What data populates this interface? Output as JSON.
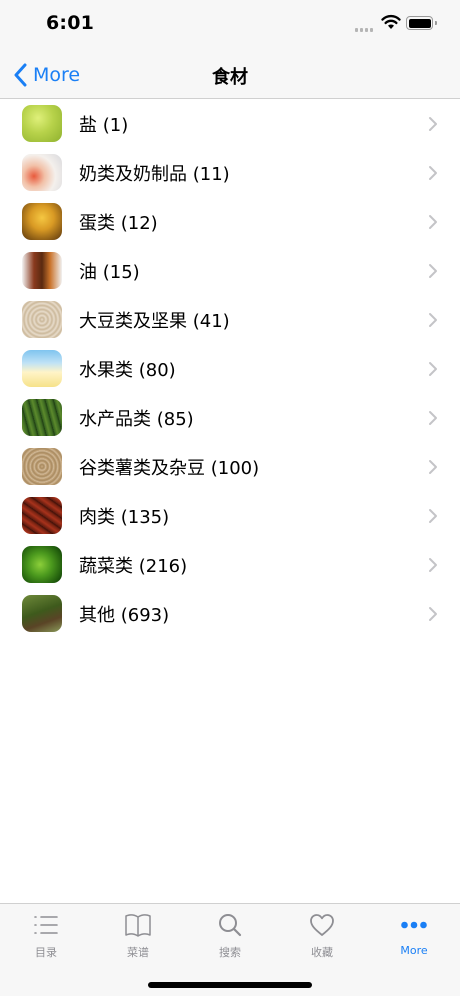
{
  "status_bar": {
    "time": "6:01"
  },
  "nav": {
    "back_label": "More",
    "title": "食材"
  },
  "colors": {
    "accent": "#1a7ff5",
    "inactive": "#8e8e93",
    "separator": "#d0d0d0",
    "bar_background": "#f7f7f7"
  },
  "categories": [
    {
      "label": "盐 (1)",
      "icon": "salt-thumbnail"
    },
    {
      "label": "奶类及奶制品 (11)",
      "icon": "dairy-thumbnail"
    },
    {
      "label": "蛋类 (12)",
      "icon": "egg-thumbnail"
    },
    {
      "label": "油 (15)",
      "icon": "oil-thumbnail"
    },
    {
      "label": "大豆类及坚果 (41)",
      "icon": "soy-nuts-thumbnail"
    },
    {
      "label": "水果类 (80)",
      "icon": "fruit-thumbnail"
    },
    {
      "label": "水产品类 (85)",
      "icon": "seafood-thumbnail"
    },
    {
      "label": "谷类薯类及杂豆 (100)",
      "icon": "grain-thumbnail"
    },
    {
      "label": "肉类 (135)",
      "icon": "meat-thumbnail"
    },
    {
      "label": "蔬菜类 (216)",
      "icon": "vegetable-thumbnail"
    },
    {
      "label": "其他 (693)",
      "icon": "other-thumbnail"
    }
  ],
  "tabs": [
    {
      "label": "目录",
      "icon": "list-icon",
      "active": false
    },
    {
      "label": "菜谱",
      "icon": "book-icon",
      "active": false
    },
    {
      "label": "搜索",
      "icon": "search-icon",
      "active": false
    },
    {
      "label": "收藏",
      "icon": "heart-icon",
      "active": false
    },
    {
      "label": "More",
      "icon": "more-icon",
      "active": true
    }
  ]
}
